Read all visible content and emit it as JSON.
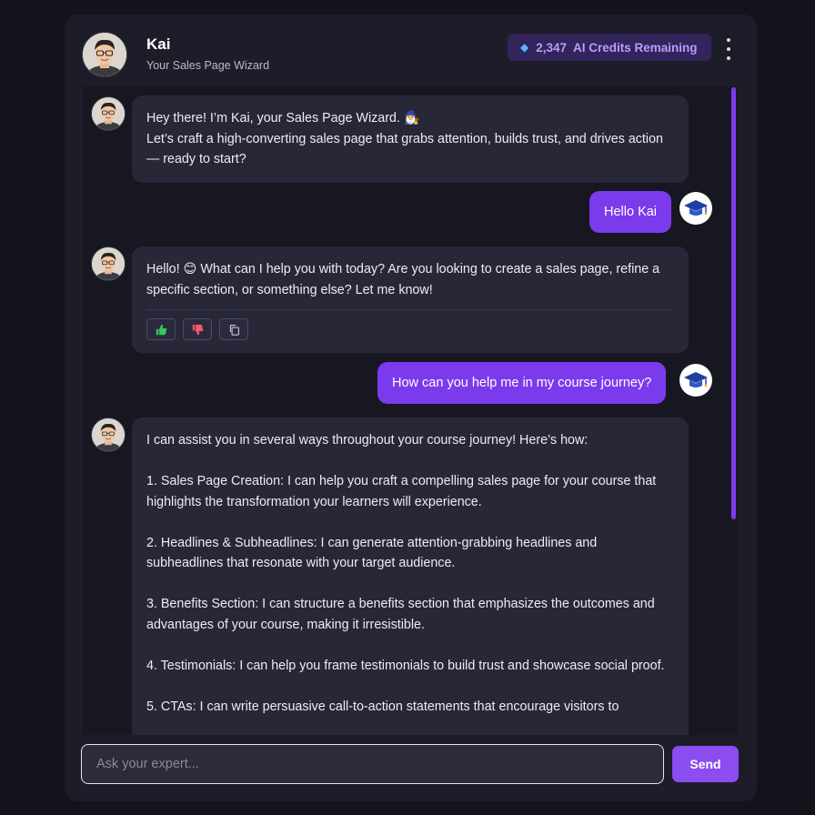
{
  "header": {
    "name": "Kai",
    "subtitle": "Your Sales Page Wizard",
    "credits": "2,347  AI Credits Remaining"
  },
  "messages": {
    "m1": {
      "line1": "Hey there! I’m Kai, your Sales Page Wizard. 🧙‍♂️",
      "line2": "Let’s craft a high-converting sales page that grabs attention, builds trust, and drives action — ready to start?"
    },
    "u1": "Hello Kai",
    "m2": {
      "text": "Hello! 😊 What can I help you with today? Are you looking to create a sales page, refine a specific section, or something else? Let me know!"
    },
    "u2": "How can you help me in my course journey?",
    "m3": {
      "intro": "I can assist you in several ways throughout your course journey! Here’s how:",
      "items": [
        "1. Sales Page Creation: I can help you craft a compelling sales page for your course that highlights the transformation your learners will experience.",
        "2. Headlines & Subheadlines: I can generate attention-grabbing headlines and subheadlines that resonate with your target audience.",
        "3. Benefits Section: I can structure a benefits section that emphasizes the outcomes and advantages of your course, making it irresistible.",
        "4. Testimonials: I can help you frame testimonials to build trust and showcase social proof.",
        "5. CTAs: I can write persuasive call-to-action statements that encourage visitors to"
      ]
    }
  },
  "composer": {
    "placeholder": "Ask your expert...",
    "send_label": "Send"
  },
  "colors": {
    "accent": "#7c3aed",
    "panel": "#1d1d29",
    "bubble": "#272738"
  },
  "icons": {
    "credits": "diamond-icon",
    "menu": "more-vertical-icon",
    "user_avatar": "graduation-cap-icon",
    "like": "thumbs-up-icon",
    "dislike": "thumbs-down-icon",
    "copy": "copy-icon"
  }
}
